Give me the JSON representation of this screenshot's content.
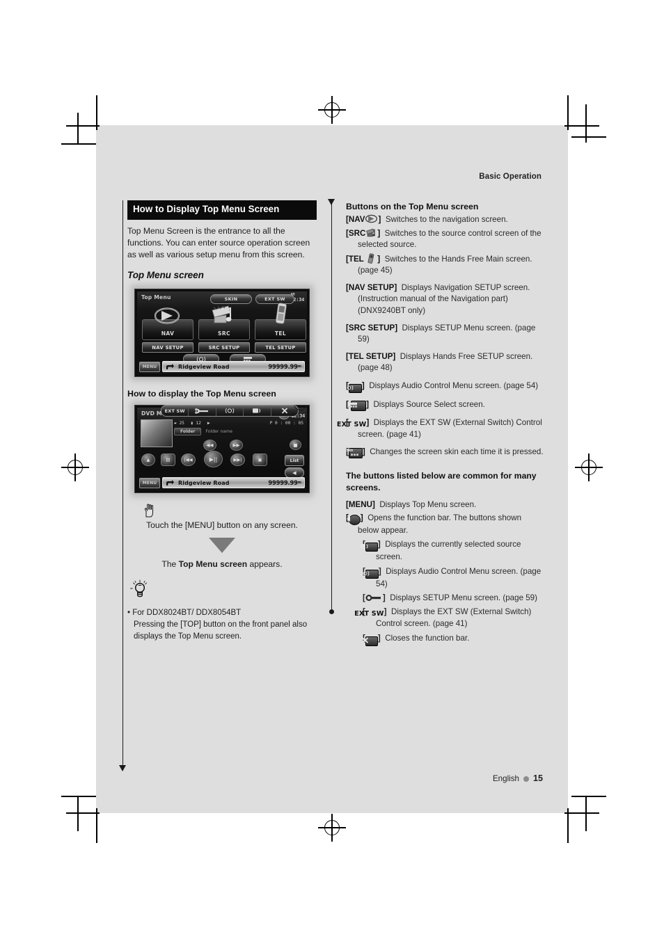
{
  "running_head": "Basic Operation",
  "footer": {
    "language": "English",
    "page": "15"
  },
  "left": {
    "section_title": "How to Display Top Menu Screen",
    "intro": "Top Menu Screen is the entrance to all the functions. You can enter source operation screen as well as various setup menu from this screen.",
    "sub_title_1": "Top Menu screen",
    "sub_title_2": "How to display the Top Menu screen",
    "touch_line": "Touch the [MENU] button on any screen.",
    "appears_prefix": "The ",
    "appears_bold": "Top Menu screen",
    "appears_suffix": " appears.",
    "tip_line_1": "For DDX8024BT/ DDX8054BT",
    "tip_line_2": "Pressing the [TOP] button on the front panel also displays the Top Menu screen."
  },
  "shot_top_menu": {
    "label": "Top Menu",
    "clock_ampm": "AM",
    "clock_time": "12:34",
    "pill_skin": "SKIN",
    "pill_extsw": "EXT SW",
    "btn_nav": "NAV",
    "btn_src": "SRC",
    "btn_tel": "TEL",
    "setup_nav": "NAV SETUP",
    "setup_src": "SRC SETUP",
    "setup_tel": "TEL SETUP",
    "menu_key": "MENU",
    "road": "Ridgeview Road",
    "distance": "99999.99",
    "unit": "m"
  },
  "shot_dvd": {
    "funcbar": [
      "EXT SW",
      "wrench-icon",
      "audio-icon",
      "source-icon",
      "close-icon"
    ],
    "label": "DVD MEDIA",
    "clock_ampm": "AM",
    "clock_time": "12:34",
    "info_folder": "25",
    "info_file": "12",
    "info_play": "P  0 : 00 : 05",
    "folder_chip": "Folder",
    "folder_name": "Folder name",
    "list_btn": "List",
    "menu_key": "MENU",
    "road": "Ridgeview Road",
    "distance": "99999.99",
    "unit": "m"
  },
  "right": {
    "heading": "Buttons on the Top Menu screen",
    "items": [
      {
        "key": "[NAV",
        "icon": "nav-globe-icon",
        "key_close": "]",
        "desc": "Switches to the navigation screen."
      },
      {
        "key": "[SRC",
        "icon": "src-media-icon",
        "key_close": "]",
        "desc": "Switches to the source control screen of the selected source."
      },
      {
        "key": "[TEL",
        "icon": "tel-phone-icon",
        "key_close": "]",
        "desc": "Switches to the Hands Free Main screen. (page 45)"
      },
      {
        "key": "[NAV SETUP]",
        "desc": "Displays Navigation SETUP screen. (Instruction manual of the Navigation part) (DNX9240BT only)"
      },
      {
        "key": "[SRC SETUP]",
        "desc": "Displays SETUP Menu screen. (page 59)"
      },
      {
        "key": "[TEL SETUP]",
        "desc": "Displays Hands Free SETUP screen. (page 48)"
      },
      {
        "key": "[",
        "icon": "audio-control-icon",
        "key_close": "]",
        "desc": "Displays Audio Control Menu screen. (page 54)"
      },
      {
        "key": "[",
        "icon": "source-select-icon",
        "key_close": "]",
        "desc": "Displays Source Select screen."
      },
      {
        "key": "[",
        "icon": "ext-sw-icon",
        "icon_text": "EXT SW",
        "key_close": "]",
        "desc": "Displays the EXT SW (External Switch) Control screen. (page 41)"
      },
      {
        "key": "[",
        "icon": "skin-icon",
        "icon_text": "Skin",
        "key_close": "]",
        "desc": "Changes the screen skin each time it is pressed."
      }
    ],
    "common_note": "The buttons listed below are common for many screens.",
    "common_items": [
      {
        "key": "[MENU]",
        "desc": "Displays Top Menu screen."
      },
      {
        "key": "[",
        "icon": "open-funcbar-icon",
        "key_close": "]",
        "desc": "Opens the function bar. The buttons shown below appear."
      }
    ],
    "sub_items": [
      {
        "key": "[",
        "icon": "source-screen-icon",
        "key_close": "]",
        "desc": "Displays the currently selected source screen."
      },
      {
        "key": "[",
        "icon": "audio-control-icon",
        "key_close": "]",
        "desc": "Displays Audio Control Menu screen. (page 54)"
      },
      {
        "key": "[",
        "icon": "setup-wrench-icon",
        "key_close": "]",
        "desc": "Displays SETUP Menu screen. (page 59)"
      },
      {
        "key": "[",
        "icon": "ext-sw-icon",
        "icon_text": "EXT SW",
        "key_close": "]",
        "desc": "Displays the EXT SW (External Switch) Control screen. (page 41)"
      },
      {
        "key": "[",
        "icon": "close-funcbar-icon",
        "key_close": "]",
        "desc": "Closes the function bar."
      }
    ]
  },
  "colors": {
    "sheet": "#dedede",
    "title_bar": "#0b0b0b",
    "text": "#1c1c1c"
  }
}
